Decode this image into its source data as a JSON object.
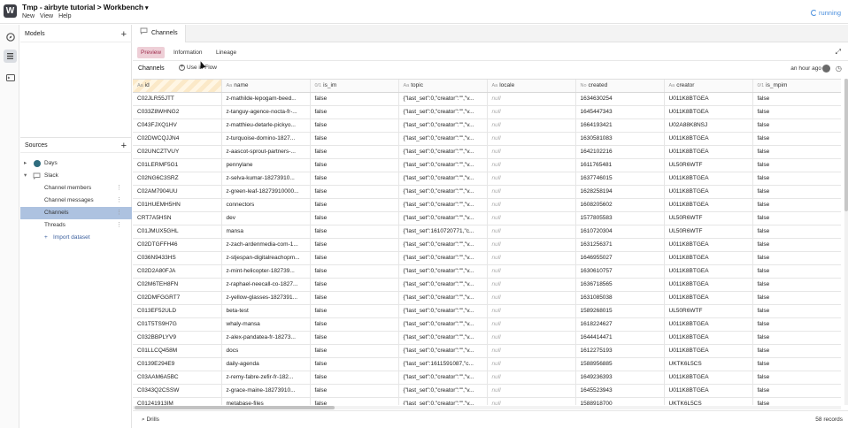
{
  "app": {
    "logo": "W",
    "title": "Tmp - airbyte tutorial > Workbench",
    "title_caret": "▾",
    "menu": [
      "New",
      "View",
      "Help"
    ],
    "status": "running"
  },
  "rail": {
    "icons": [
      "compass-icon",
      "list-icon",
      "terminal-icon"
    ]
  },
  "sidebar": {
    "models": {
      "title": "Models",
      "add": "+"
    },
    "sources": {
      "title": "Sources",
      "add": "+",
      "items": [
        {
          "label": "Days",
          "arrow": "▸",
          "icon": "database-icon",
          "level": 0
        },
        {
          "label": "Slack",
          "arrow": "▾",
          "icon": "chat-icon",
          "level": 0
        },
        {
          "label": "Channel members",
          "level": 1,
          "kebab": "⋮"
        },
        {
          "label": "Channel messages",
          "level": 1,
          "kebab": "⋮"
        },
        {
          "label": "Channels",
          "level": 1,
          "kebab": "⋮",
          "selected": true
        },
        {
          "label": "Threads",
          "level": 1,
          "kebab": "⋮"
        },
        {
          "label": "Import dataset",
          "level": 1,
          "prefix": "+",
          "link": true
        }
      ]
    }
  },
  "tab": {
    "label": "Channels",
    "icon": "chat-icon"
  },
  "subtabs": [
    "Preview",
    "Information",
    "Lineage"
  ],
  "active_subtab": "Preview",
  "toolbar": {
    "label": "Channels",
    "use_flow": "Use in Flow",
    "updated": "an hour ago"
  },
  "table": {
    "columns": [
      {
        "type": "Aa",
        "name": "id"
      },
      {
        "type": "Aa",
        "name": "name"
      },
      {
        "type": "0/1",
        "name": "is_im"
      },
      {
        "type": "Aa",
        "name": "topic"
      },
      {
        "type": "Aa",
        "name": "locale"
      },
      {
        "type": "No",
        "name": "created"
      },
      {
        "type": "Aa",
        "name": "creator"
      },
      {
        "type": "0/1",
        "name": "is_mpim"
      }
    ],
    "rows": [
      [
        "C02JLR55JTT",
        "z-mathilde-lepogam-beed...",
        "false",
        "{\"last_set\":0,\"creator\":\"\",\"v...",
        "null",
        "1634630254",
        "U011K8BTGEA",
        "false"
      ],
      [
        "C033Z8WHNG2",
        "z-tanguy-agence-nocta-fr-...",
        "false",
        "{\"last_set\":0,\"creator\":\"\",\"v...",
        "null",
        "1645447343",
        "U011K8BTGEA",
        "false"
      ],
      [
        "C043FJXQ1HV",
        "z-matthieu-detarle-pickyo...",
        "false",
        "{\"last_set\":0,\"creator\":\"\",\"v...",
        "null",
        "1664193421",
        "U02A88K8NSJ",
        "false"
      ],
      [
        "C02DWCQJJN4",
        "z-turquoise-domino-1827...",
        "false",
        "{\"last_set\":0,\"creator\":\"\",\"v...",
        "null",
        "1630581083",
        "U011K8BTGEA",
        "false"
      ],
      [
        "C02UNCZTVUY",
        "z-aascot-sprout-partners-...",
        "false",
        "{\"last_set\":0,\"creator\":\"\",\"v...",
        "null",
        "1642102216",
        "U011K8BTGEA",
        "false"
      ],
      [
        "C01LERMF5G1",
        "pennylane",
        "false",
        "{\"last_set\":0,\"creator\":\"\",\"v...",
        "null",
        "1611765481",
        "UL50R6WTF",
        "false"
      ],
      [
        "C02NG6C3SRZ",
        "z-selva-kumar-18273910...",
        "false",
        "{\"last_set\":0,\"creator\":\"\",\"v...",
        "null",
        "1637746015",
        "U011K8BTGEA",
        "false"
      ],
      [
        "C02AM7904UU",
        "z-green-leaf-18273910000...",
        "false",
        "{\"last_set\":0,\"creator\":\"\",\"v...",
        "null",
        "1628258194",
        "U011K8BTGEA",
        "false"
      ],
      [
        "C01HUEMH5HN",
        "connectors",
        "false",
        "{\"last_set\":0,\"creator\":\"\",\"v...",
        "null",
        "1608205602",
        "U011K8BTGEA",
        "false"
      ],
      [
        "CRT7A5HSN",
        "dev",
        "false",
        "{\"last_set\":0,\"creator\":\"\",\"v...",
        "null",
        "1577805583",
        "UL50R6WTF",
        "false"
      ],
      [
        "C01JMUX5GHL",
        "mansa",
        "false",
        "{\"last_set\":1610720771,\"c...",
        "null",
        "1610720304",
        "UL50R6WTF",
        "false"
      ],
      [
        "C02DTGFFH46",
        "z-zach-ardenmedia-com-1...",
        "false",
        "{\"last_set\":0,\"creator\":\"\",\"v...",
        "null",
        "1631256371",
        "U011K8BTGEA",
        "false"
      ],
      [
        "C036N9433HS",
        "z-stjespan-digitalreachopm...",
        "false",
        "{\"last_set\":0,\"creator\":\"\",\"v...",
        "null",
        "1646955027",
        "U011K8BTGEA",
        "false"
      ],
      [
        "C02D2A80FJA",
        "z-mint-helicopter-182739...",
        "false",
        "{\"last_set\":0,\"creator\":\"\",\"v...",
        "null",
        "1630610757",
        "U011K8BTGEA",
        "false"
      ],
      [
        "C02M6TEH8FN",
        "z-raphael-neecall-co-1827...",
        "false",
        "{\"last_set\":0,\"creator\":\"\",\"v...",
        "null",
        "1636718565",
        "U011K8BTGEA",
        "false"
      ],
      [
        "C02DMFGGRT7",
        "z-yellow-glasses-1827391...",
        "false",
        "{\"last_set\":0,\"creator\":\"\",\"v...",
        "null",
        "1631085038",
        "U011K8BTGEA",
        "false"
      ],
      [
        "C013EF52ULD",
        "beta-test",
        "false",
        "{\"last_set\":0,\"creator\":\"\",\"v...",
        "null",
        "1589268015",
        "UL50R6WTF",
        "false"
      ],
      [
        "C01T5TS9H7G",
        "whaly-mansa",
        "false",
        "{\"last_set\":0,\"creator\":\"\",\"v...",
        "null",
        "1618224627",
        "U011K8BTGEA",
        "false"
      ],
      [
        "C032BBPLYV9",
        "z-alex-pandatea-fr-18273...",
        "false",
        "{\"last_set\":0,\"creator\":\"\",\"v...",
        "null",
        "1644414471",
        "U011K8BTGEA",
        "false"
      ],
      [
        "C01LLCQ458M",
        "docs",
        "false",
        "{\"last_set\":0,\"creator\":\"\",\"v...",
        "null",
        "1612275193",
        "U011K8BTGEA",
        "false"
      ],
      [
        "C0139E294E9",
        "daily-agenda",
        "false",
        "{\"last_set\":1611591087,\"c...",
        "null",
        "1588956885",
        "UKTK6L5CS",
        "false"
      ],
      [
        "C03AAM6A5BC",
        "z-remy-fabre-zefir-fr-182...",
        "false",
        "{\"last_set\":0,\"creator\":\"\",\"v...",
        "null",
        "1649236393",
        "U011K8BTGEA",
        "false"
      ],
      [
        "C0343Q2CSSW",
        "z-grace-maine-18273910...",
        "false",
        "{\"last_set\":0,\"creator\":\"\",\"v...",
        "null",
        "1645523943",
        "U011K8BTGEA",
        "false"
      ],
      [
        "C01241913IM",
        "metabase-files",
        "false",
        "{\"last_set\":0,\"creator\":\"\",\"v...",
        "null",
        "1588918700",
        "UKTK6L5CS",
        "false"
      ]
    ]
  },
  "footer": {
    "drills": "Drills",
    "records": "58 records"
  }
}
